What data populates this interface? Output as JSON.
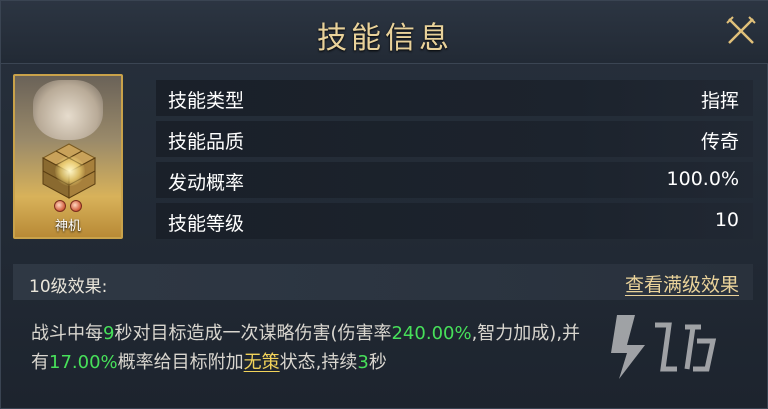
{
  "title": "技能信息",
  "card": {
    "name": "神机"
  },
  "info_rows": [
    {
      "label": "技能类型",
      "value": "指挥"
    },
    {
      "label": "技能品质",
      "value": "传奇"
    },
    {
      "label": "发动概率",
      "value": "100.0%"
    },
    {
      "label": "技能等级",
      "value": "10"
    }
  ],
  "effect": {
    "level_label": "10级效果:",
    "full_link": "查看满级效果",
    "desc": {
      "t1": "战斗中每",
      "n1": "9",
      "t2": "秒对目标造成一次谋略伤害(伤害率",
      "n2": "240.00%",
      "t3": ",智力加成),并",
      "t4": "有",
      "n3": "17.00%",
      "t5": "概率给目标附加",
      "k1": "无策",
      "t6": "状态,持续",
      "n4": "3",
      "t7": "秒"
    }
  },
  "colors": {
    "title_gold": "#e9d29a",
    "highlight_green": "#47e05a",
    "keyword_yellow": "#f2d35a"
  },
  "icons": {
    "close": "crossed-swords-icon"
  }
}
